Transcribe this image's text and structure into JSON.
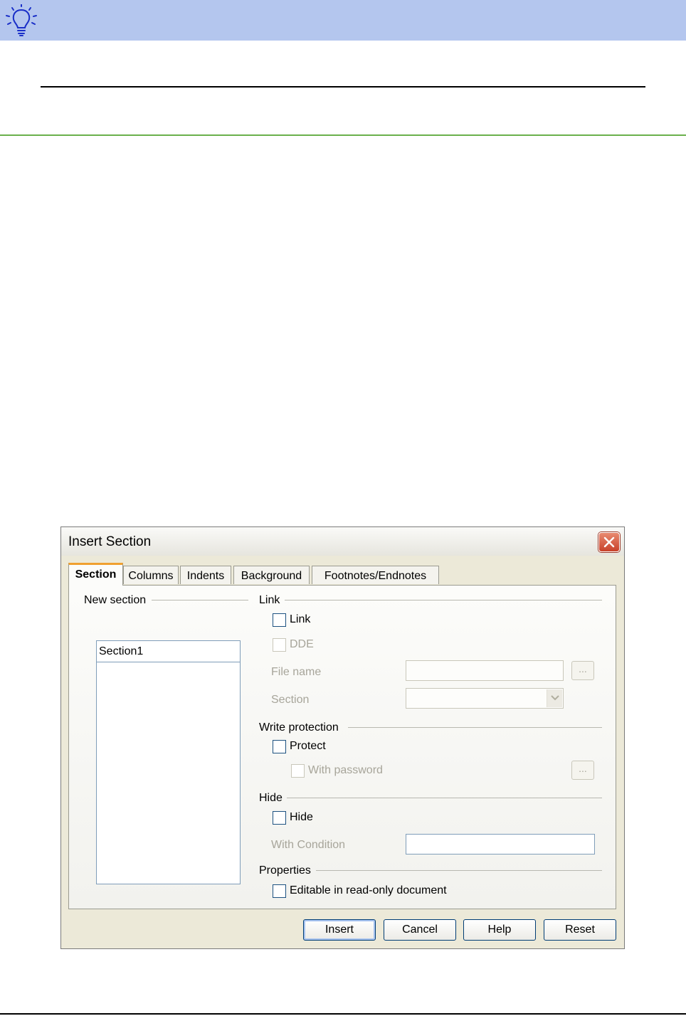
{
  "tip": {
    "icon": "lightbulb-icon",
    "accent": "#b4c6ee"
  },
  "dialog": {
    "title": "Insert Section",
    "tabs": [
      {
        "label": "Section",
        "active": true
      },
      {
        "label": "Columns",
        "active": false
      },
      {
        "label": "Indents",
        "active": false
      },
      {
        "label": "Background",
        "active": false
      },
      {
        "label": "Footnotes/Endnotes",
        "active": false
      }
    ],
    "new_section": {
      "label": "New section",
      "value": "Section1"
    },
    "link_group": {
      "label": "Link",
      "link_checkbox": "Link",
      "dde_checkbox": "DDE",
      "file_name_label": "File name",
      "section_label": "Section",
      "browse_label": "..."
    },
    "write_protection": {
      "label": "Write protection",
      "protect_checkbox": "Protect",
      "with_password_checkbox": "With password",
      "password_button": "..."
    },
    "hide_group": {
      "label": "Hide",
      "hide_checkbox": "Hide",
      "condition_label": "With Condition"
    },
    "properties": {
      "label": "Properties",
      "editable_checkbox": "Editable in read-only document"
    },
    "buttons": {
      "insert": "Insert",
      "cancel": "Cancel",
      "help": "Help",
      "reset": "Reset"
    }
  }
}
